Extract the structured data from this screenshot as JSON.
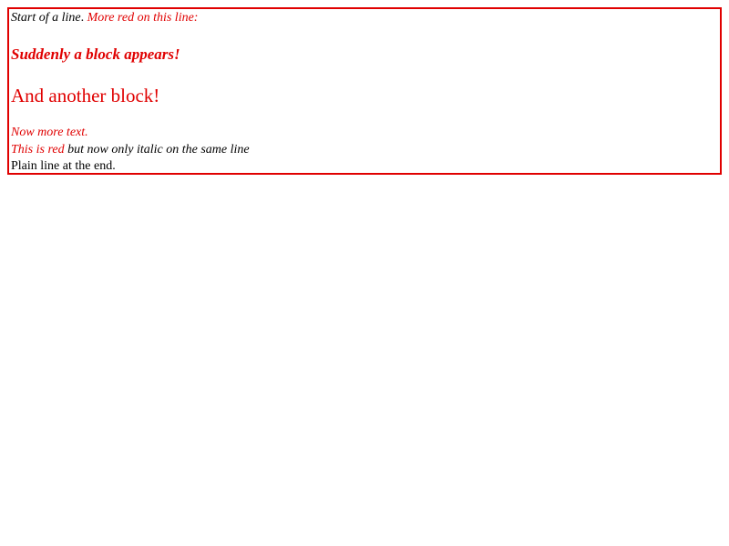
{
  "lines": {
    "line1_part1": "Start of a line",
    "line1_dot": ".",
    "line1_part2": " More red on this line:",
    "line2": "Suddenly a block appears!",
    "line3": "And another block!",
    "line4": "Now more text.",
    "line5_red": "This is red",
    "line5_black": " but now only italic on the same line",
    "line6": "Plain line at the end."
  },
  "colors": {
    "border": "#e00000",
    "red_text": "#e00000",
    "black_text": "#000000"
  }
}
